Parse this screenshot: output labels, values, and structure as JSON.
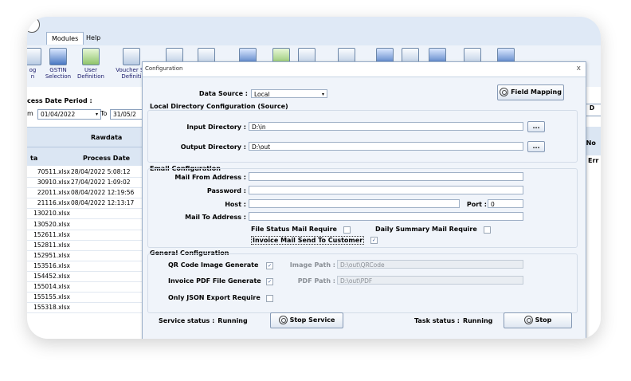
{
  "ribbon": {
    "tabs": [
      "Modules",
      "Help"
    ],
    "tools": [
      {
        "label": "og\nn",
        "icon": "import-icon"
      },
      {
        "label": "GSTIN\nSelection",
        "icon": "gstin-icon"
      },
      {
        "label": "User\nDefinition",
        "icon": "user-definition-icon"
      },
      {
        "label": "Voucher Se\nDefiniti",
        "icon": "voucher-icon"
      }
    ]
  },
  "left": {
    "period_label": "cess Date Period :",
    "from_prefix": "m",
    "from_date": "01/04/2022",
    "to_label": "To",
    "to_date": "31/05/2",
    "group_header": "Rawdata",
    "col1": "ta",
    "col2": "Process Date",
    "rows": [
      {
        "file": "70511.xlsx",
        "date": "28/04/2022 5:08:12"
      },
      {
        "file": "30910.xlsx",
        "date": "27/04/2022 1:09:02"
      },
      {
        "file": "22011.xlsx",
        "date": "08/04/2022 12:19:56"
      },
      {
        "file": "21116.xlsx",
        "date": "08/04/2022 12:13:17"
      },
      {
        "file": "130210.xlsx",
        "date": ""
      },
      {
        "file": "130520.xlsx",
        "date": ""
      },
      {
        "file": "152611.xlsx",
        "date": ""
      },
      {
        "file": "152811.xlsx",
        "date": ""
      },
      {
        "file": "152951.xlsx",
        "date": ""
      },
      {
        "file": "153516.xlsx",
        "date": ""
      },
      {
        "file": "154452.xlsx",
        "date": ""
      },
      {
        "file": "155014.xlsx",
        "date": ""
      },
      {
        "file": "155155.xlsx",
        "date": ""
      },
      {
        "file": "155318.xlsx",
        "date": ""
      }
    ],
    "right_header1": "↓ D",
    "right_header2": "(No",
    "right_header3": "Err"
  },
  "dialog": {
    "title": "Configuration",
    "close": "x",
    "data_source_label": "Data Source :",
    "data_source_value": "Local",
    "field_mapping": "Field Mapping",
    "local_dir_section": "Local Directory Configuration (Source)",
    "input_dir_label": "Input Directory :",
    "input_dir_value": "D:\\in",
    "output_dir_label": "Output Directory :",
    "output_dir_value": "D:\\out",
    "browse": "...",
    "email_section": "Email Configuration",
    "mail_from_label": "Mail From Address :",
    "mail_from_value": "",
    "password_label": "Password :",
    "host_label": "Host :",
    "port_label": "Port :",
    "port_value": "0",
    "mail_to_label": "Mail To Address :",
    "file_status_label": "File Status Mail Require",
    "daily_summary_label": "Daily Summary Mail Require",
    "invoice_mail_label": "Invoice Mail Send To Customer",
    "general_section": "General Configuration",
    "qr_label": "QR Code Image Generate",
    "image_path_label": "Image Path :",
    "image_path_value": "D:\\out\\QRCode",
    "pdf_label": "Invoice PDF File Generate",
    "pdf_path_label": "PDF Path :",
    "pdf_path_value": "D:\\out\\PDF",
    "json_label": "Only JSON Export Require",
    "service_status_label": "Service status :",
    "service_status_value": "Running",
    "stop_service": "Stop Service",
    "task_status_label": "Task status :",
    "task_status_value": "Running",
    "stop": "Stop",
    "check_mark": "✓"
  }
}
